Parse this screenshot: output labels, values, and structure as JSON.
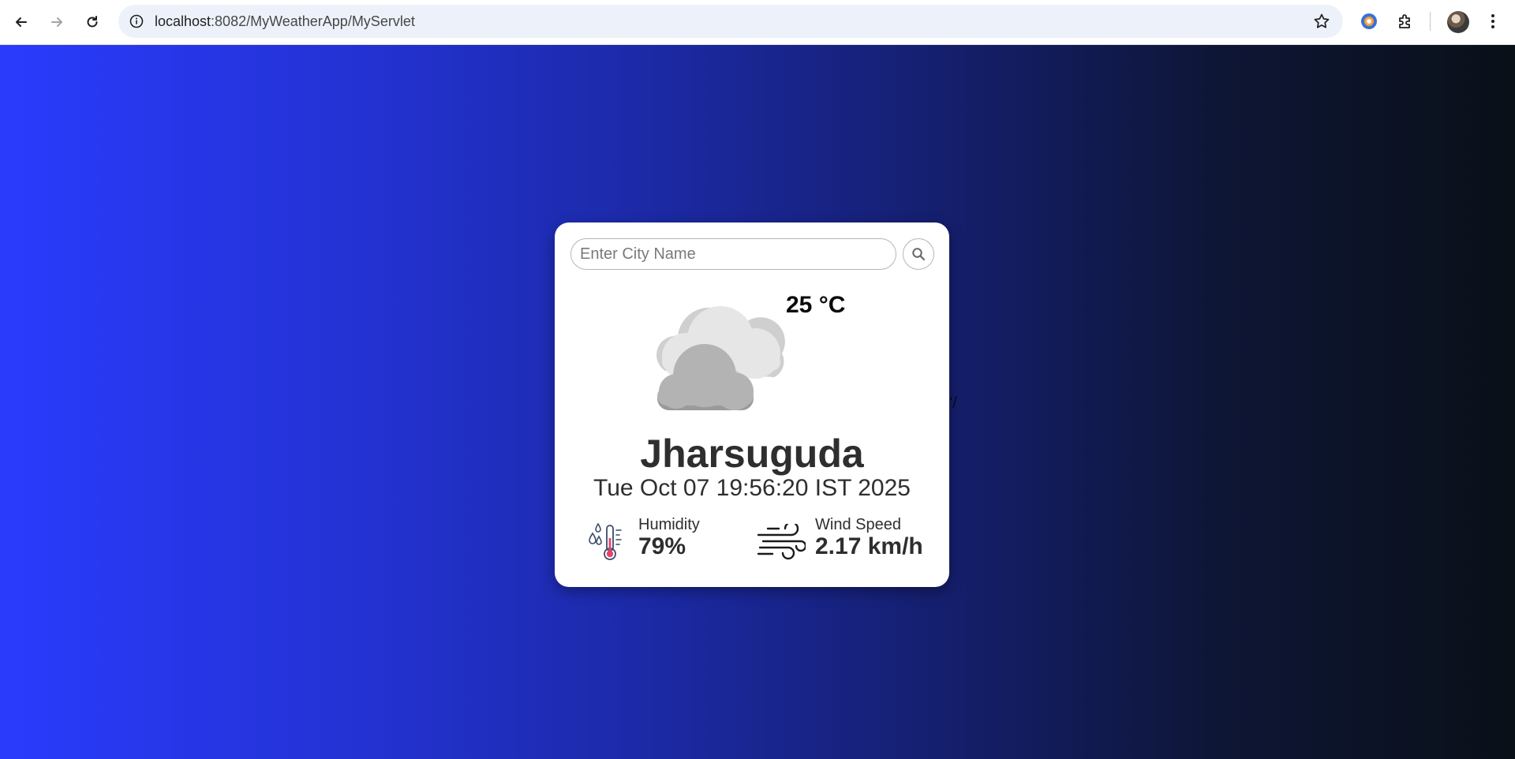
{
  "browser": {
    "url_host": "localhost",
    "url_path": ":8082/MyWeatherApp/MyServlet"
  },
  "page": {
    "stray_text": "\"/"
  },
  "weather": {
    "search_placeholder": "Enter City Name",
    "temperature": "25 °C",
    "city": "Jharsuguda",
    "datetime": "Tue Oct 07 19:56:20 IST 2025",
    "humidity_label": "Humidity",
    "humidity_value": "79%",
    "wind_label": "Wind Speed",
    "wind_value": "2.17 km/h",
    "condition_icon": "cloudy-icon"
  },
  "colors": {
    "gradient_start": "#2a3bfd",
    "gradient_end": "#0a1018",
    "card": "#ffffff"
  }
}
